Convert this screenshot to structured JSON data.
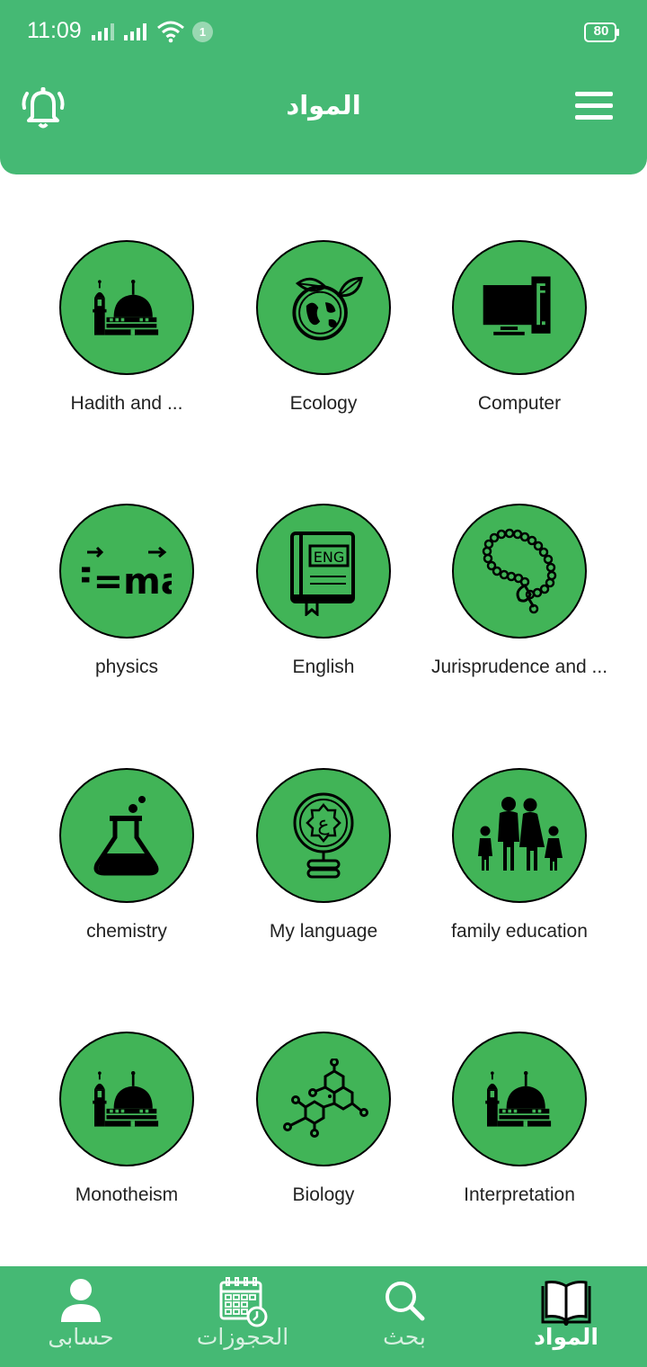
{
  "status_bar": {
    "time": "11:09",
    "notification_count": "1",
    "battery": "80"
  },
  "header": {
    "title": "المواد"
  },
  "subjects": [
    {
      "label": "Hadith and ...",
      "icon": "mosque-icon"
    },
    {
      "label": "Ecology",
      "icon": "globe-leaves-icon"
    },
    {
      "label": "Computer",
      "icon": "computer-icon"
    },
    {
      "label": "physics",
      "icon": "formula-icon",
      "icon_text": "F=ma"
    },
    {
      "label": "English",
      "icon": "english-book-icon",
      "icon_text": "ENG"
    },
    {
      "label": "Jurisprudence and ...",
      "icon": "prayer-beads-icon"
    },
    {
      "label": "chemistry",
      "icon": "flask-icon"
    },
    {
      "label": "My language",
      "icon": "arabic-letter-icon",
      "icon_text": "ع"
    },
    {
      "label": "family education",
      "icon": "family-icon"
    },
    {
      "label": "Monotheism",
      "icon": "mosque-icon"
    },
    {
      "label": "Biology",
      "icon": "molecule-icon"
    },
    {
      "label": "Interpretation",
      "icon": "mosque-icon"
    }
  ],
  "bottom_nav": [
    {
      "label": "حسابى",
      "icon": "user-icon",
      "active": false
    },
    {
      "label": "الحجوزات",
      "icon": "calendar-icon",
      "active": false
    },
    {
      "label": "بحث",
      "icon": "search-icon",
      "active": false
    },
    {
      "label": "المواد",
      "icon": "book-icon",
      "active": true
    }
  ],
  "colors": {
    "primary": "#45b974",
    "circle": "#41b457",
    "text": "#222222"
  }
}
